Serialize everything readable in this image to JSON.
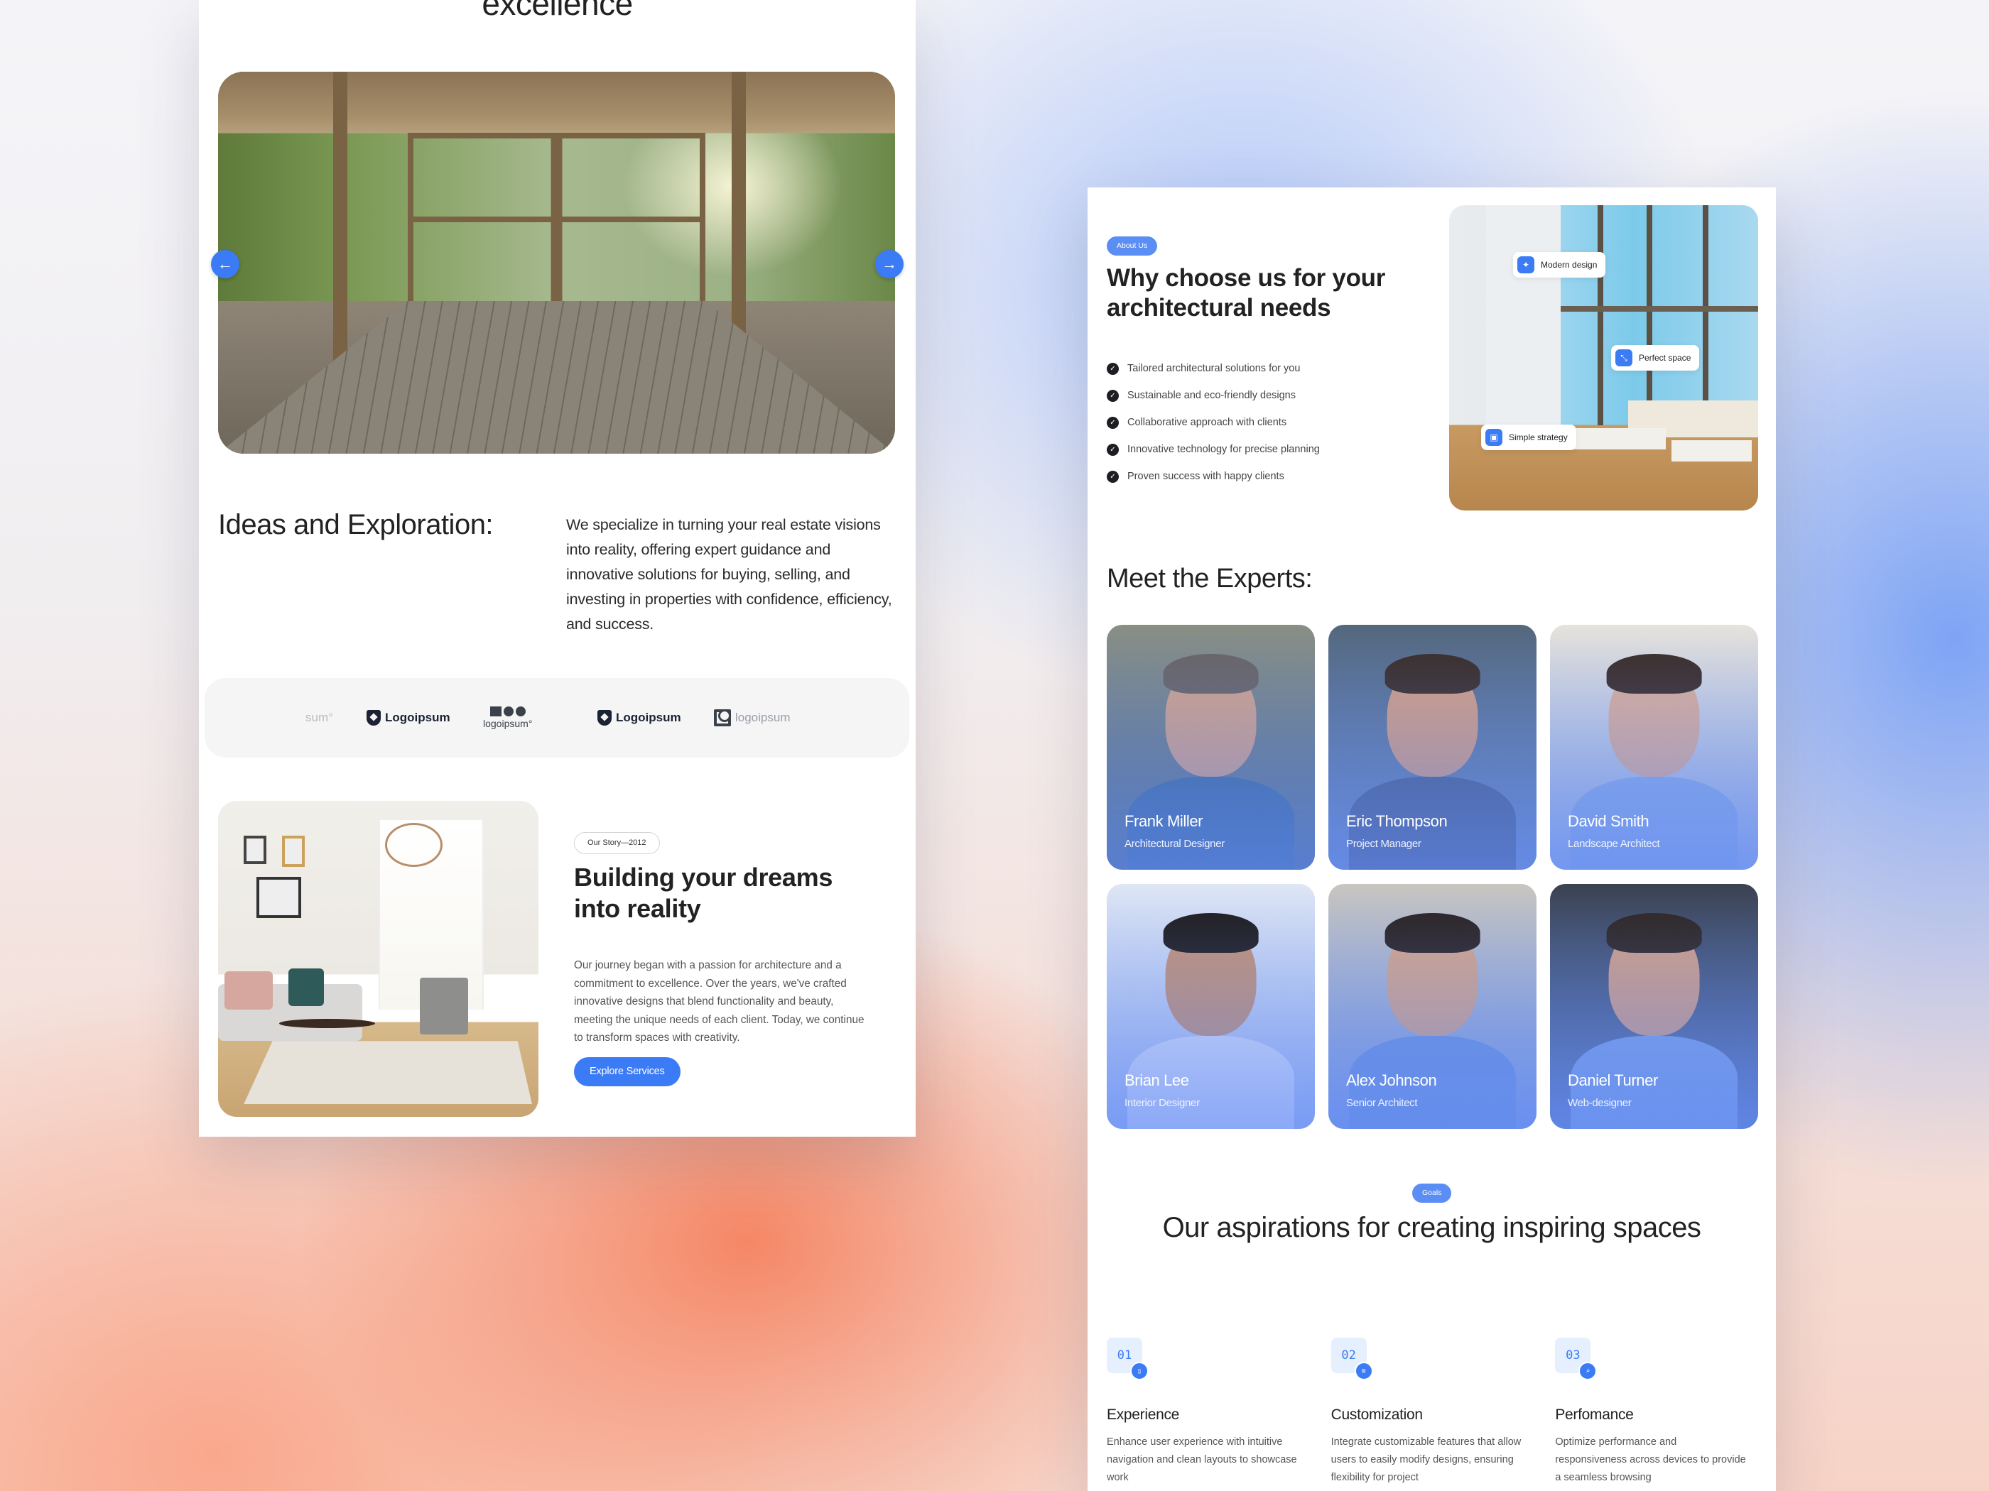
{
  "left_page": {
    "hero_title": "excellence",
    "carousel": {
      "prev_icon": "←",
      "next_icon": "→",
      "slide_count": 3,
      "active_slide": 2
    },
    "ideas": {
      "title": "Ideas and Exploration:",
      "text": "We specialize in turning your real estate visions into reality, offering expert guidance and innovative solutions for buying, selling, and investing in properties with confidence, efficiency, and success."
    },
    "logos": [
      {
        "text": "sum°",
        "style": "faded"
      },
      {
        "text": "Logoipsum",
        "style": "shield"
      },
      {
        "text": "logoipsum°",
        "style": "stack"
      },
      {
        "text": "Logoipsum",
        "style": "shield"
      },
      {
        "text": "logoipsum",
        "style": "square"
      }
    ],
    "story": {
      "pill": "Our Story—2012",
      "title": "Building your dreams into reality",
      "text": "Our journey began with a passion for architecture and a commitment to excellence. Over the years, we've crafted innovative designs that blend functionality and beauty, meeting the unique needs of each client. Today, we continue to transform spaces with creativity.",
      "button": "Explore Services"
    }
  },
  "right_page": {
    "about": {
      "pill": "About Us",
      "title": "Why choose us for your architectural needs",
      "checklist": [
        "Tailored architectural solutions for you",
        "Sustainable and eco-friendly designs",
        "Collaborative approach with clients",
        "Innovative technology for precise planning",
        "Proven success with happy clients"
      ],
      "tags": [
        {
          "label": "Modern design",
          "icon": "✦"
        },
        {
          "label": "Perfect space",
          "icon": "⤡"
        },
        {
          "label": "Simple strategy",
          "icon": "▣"
        }
      ]
    },
    "experts": {
      "title": "Meet the Experts:",
      "people": [
        {
          "name": "Frank Miller",
          "role": "Architectural Designer"
        },
        {
          "name": "Eric Thompson",
          "role": "Project Manager"
        },
        {
          "name": "David Smith",
          "role": "Landscape Architect"
        },
        {
          "name": "Brian Lee",
          "role": "Interior Designer"
        },
        {
          "name": "Alex Johnson",
          "role": "Senior Architect"
        },
        {
          "name": "Daniel Turner",
          "role": "Web-designer"
        }
      ]
    },
    "goals": {
      "pill": "Goals",
      "title": "Our aspirations for creating inspiring spaces",
      "features": [
        {
          "num": "01",
          "icon": "▯",
          "title": "Experience",
          "text": "Enhance user experience with intuitive navigation and clean layouts to showcase work"
        },
        {
          "num": "02",
          "icon": "≡",
          "title": "Customization",
          "text": "Integrate customizable features that allow users to easily modify designs, ensuring flexibility for project"
        },
        {
          "num": "03",
          "icon": "⌕",
          "title": "Perfomance",
          "text": "Optimize performance and responsiveness across devices to provide a seamless browsing"
        }
      ]
    }
  },
  "colors": {
    "accent": "#3b7bf5",
    "pill_blue": "#5b8ef5",
    "text_dark": "#222222"
  }
}
